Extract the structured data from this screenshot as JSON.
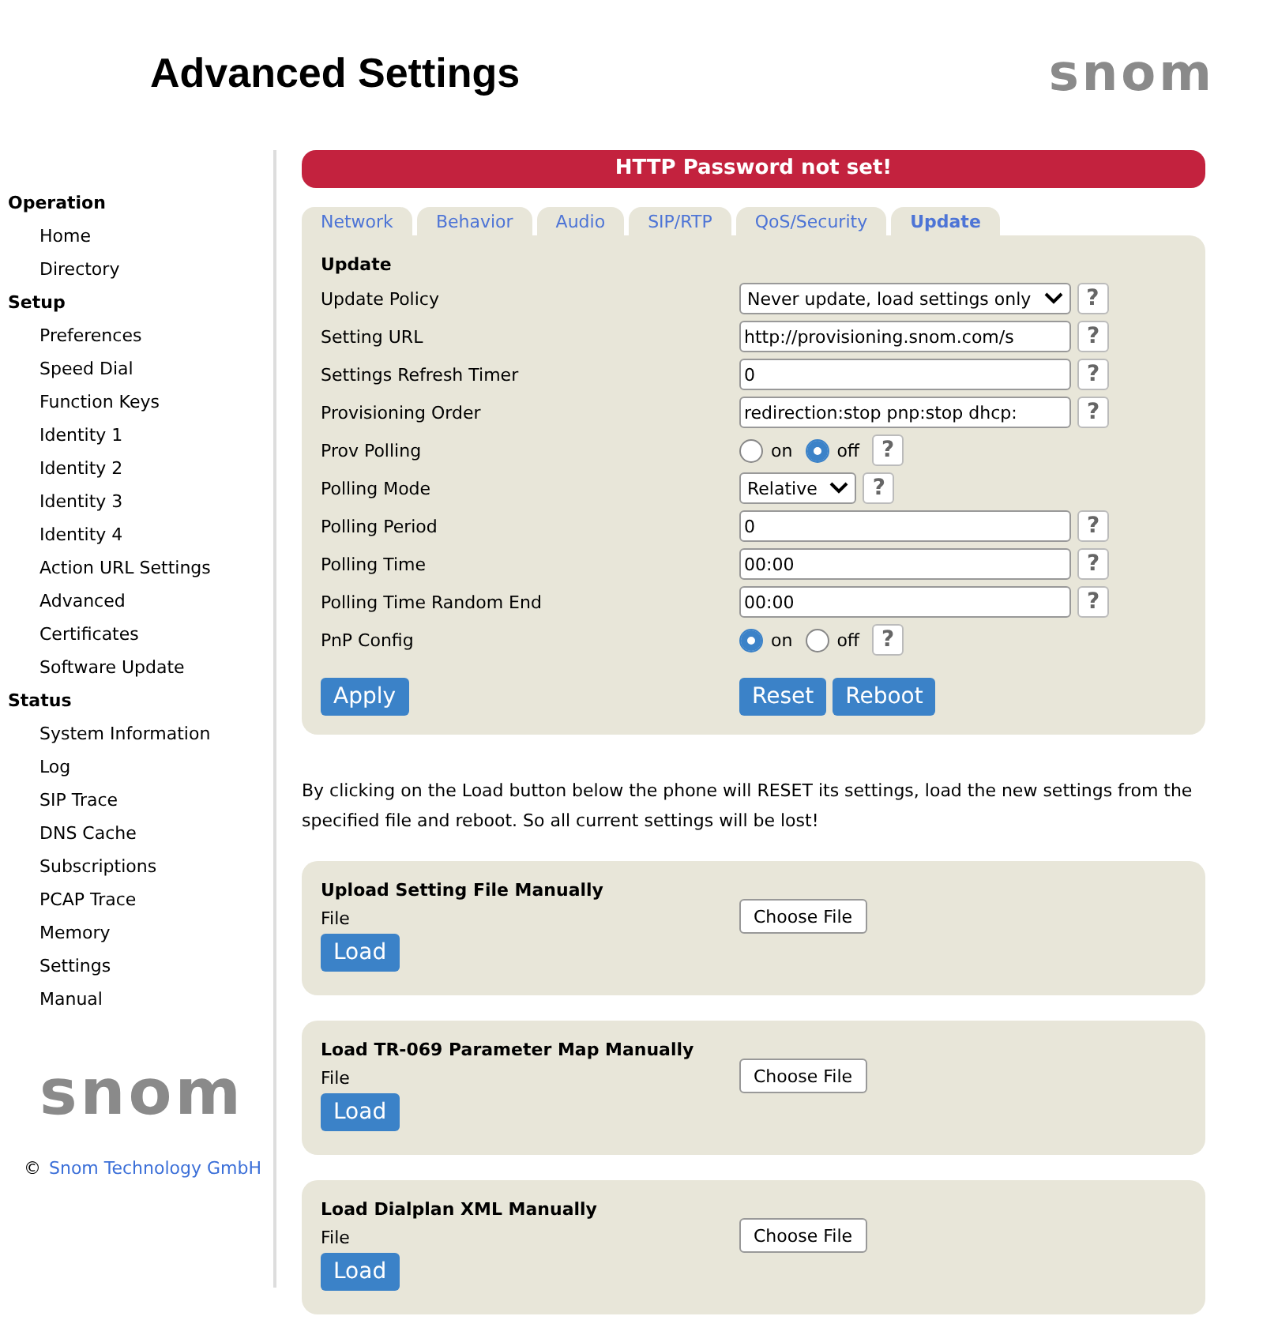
{
  "header": {
    "title": "Advanced Settings",
    "logo": "snom"
  },
  "sidebar": {
    "sections": [
      {
        "title": "Operation",
        "items": [
          "Home",
          "Directory"
        ]
      },
      {
        "title": "Setup",
        "items": [
          "Preferences",
          "Speed Dial",
          "Function Keys",
          "Identity 1",
          "Identity 2",
          "Identity 3",
          "Identity 4",
          "Action URL Settings",
          "Advanced",
          "Certificates",
          "Software Update"
        ]
      },
      {
        "title": "Status",
        "items": [
          "System Information",
          "Log",
          "SIP Trace",
          "DNS Cache",
          "Subscriptions",
          "PCAP Trace",
          "Memory",
          "Settings",
          "Manual"
        ]
      }
    ],
    "logo": "snom",
    "copyright": "©",
    "company_link": "Snom Technology GmbH"
  },
  "alert": "HTTP Password not set!",
  "tabs": [
    {
      "label": "Network",
      "selected": false
    },
    {
      "label": "Behavior",
      "selected": false
    },
    {
      "label": "Audio",
      "selected": false
    },
    {
      "label": "SIP/RTP",
      "selected": false
    },
    {
      "label": "QoS/Security",
      "selected": false
    },
    {
      "label": "Update",
      "selected": true
    }
  ],
  "form": {
    "heading": "Update",
    "help": "?",
    "rows": [
      {
        "kind": "select",
        "label": "Update Policy",
        "value": "Never update, load settings only"
      },
      {
        "kind": "text",
        "label": "Setting URL",
        "value": "http://provisioning.snom.com/s"
      },
      {
        "kind": "text",
        "label": "Settings Refresh Timer",
        "value": "0"
      },
      {
        "kind": "text",
        "label": "Provisioning Order",
        "value": "redirection:stop pnp:stop dhcp:"
      },
      {
        "kind": "radio",
        "label": "Prov Polling",
        "options": [
          {
            "label": "on",
            "selected": false
          },
          {
            "label": "off",
            "selected": true
          }
        ]
      },
      {
        "kind": "select",
        "label": "Polling Mode",
        "value": "Relative"
      },
      {
        "kind": "text",
        "label": "Polling Period",
        "value": "0"
      },
      {
        "kind": "text",
        "label": "Polling Time",
        "value": "00:00"
      },
      {
        "kind": "text",
        "label": "Polling Time Random End",
        "value": "00:00"
      },
      {
        "kind": "radio",
        "label": "PnP Config",
        "options": [
          {
            "label": "on",
            "selected": true
          },
          {
            "label": "off",
            "selected": false
          }
        ]
      }
    ],
    "apply": "Apply",
    "reset": "Reset",
    "reboot": "Reboot"
  },
  "notice": "By clicking on the Load button below the phone will RESET its settings, load the new settings from the specified file and reboot. So all current settings will be lost!",
  "uploads": [
    {
      "title": "Upload Setting File Manually",
      "label": "File",
      "choose": "Choose File",
      "button": "Load"
    },
    {
      "title": "Load TR-069 Parameter Map Manually",
      "label": "File",
      "choose": "Choose File",
      "button": "Load"
    },
    {
      "title": "Load Dialplan XML Manually",
      "label": "File",
      "choose": "Choose File",
      "button": "Load"
    }
  ]
}
